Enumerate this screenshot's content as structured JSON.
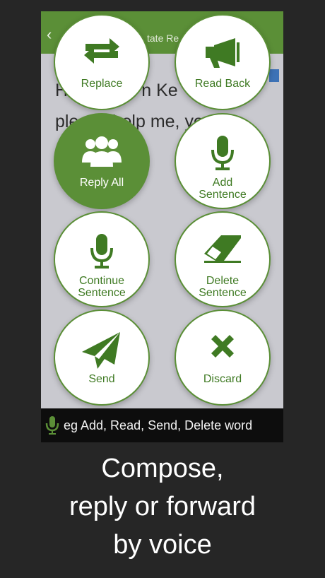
{
  "app": {
    "back_glyph": "‹",
    "title_fragment": "tate Re",
    "body_text": "H               n Ke\nplease help me, you're\n           pe."
  },
  "actions": [
    {
      "id": "replace",
      "label": "Replace",
      "icon": "repeat-icon",
      "active": false
    },
    {
      "id": "read-back",
      "label": "Read Back",
      "icon": "megaphone-icon",
      "active": false
    },
    {
      "id": "reply-all",
      "label": "Reply All",
      "icon": "group-icon",
      "active": true
    },
    {
      "id": "add-sentence",
      "label_line1": "Add",
      "label_line2": "Sentence",
      "icon": "microphone-icon",
      "active": false
    },
    {
      "id": "continue-sentence",
      "label_line1": "Continue",
      "label_line2": "Sentence",
      "icon": "microphone-icon",
      "active": false
    },
    {
      "id": "delete-sentence",
      "label_line1": "Delete",
      "label_line2": "Sentence",
      "icon": "eraser-icon",
      "active": false
    },
    {
      "id": "send",
      "label": "Send",
      "icon": "send-icon",
      "active": false
    },
    {
      "id": "discard",
      "label": "Discard",
      "icon": "close-icon",
      "active": false
    }
  ],
  "voice_hint": "eg Add, Read, Send, Delete word",
  "caption": {
    "line1": "Compose,",
    "line2": "reply or forward",
    "line3": "by voice"
  },
  "colors": {
    "accent": "#5b8f37",
    "background": "#262626"
  }
}
